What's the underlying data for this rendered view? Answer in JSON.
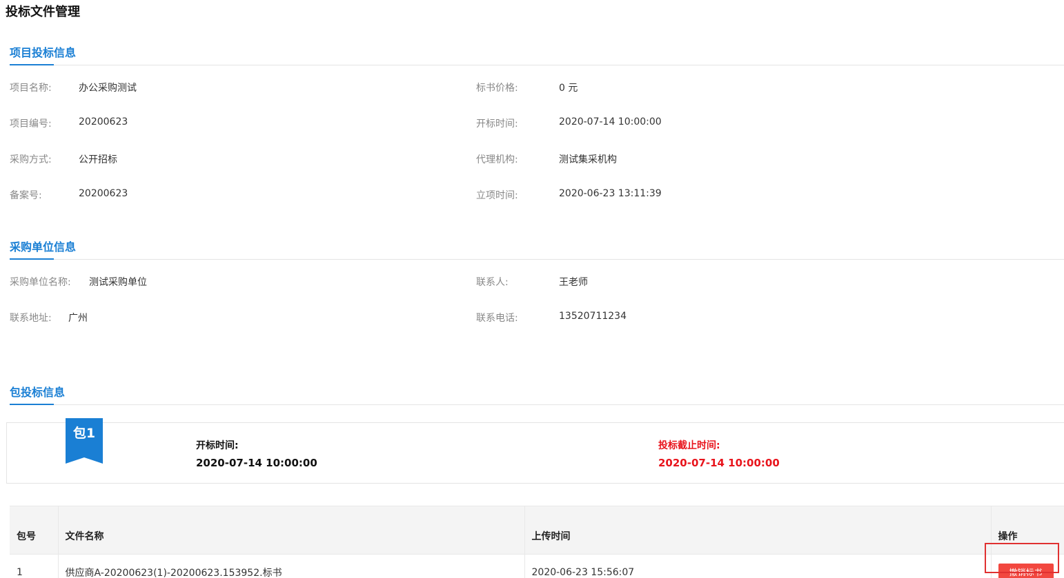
{
  "page": {
    "title": "投标文件管理"
  },
  "sections": {
    "project": "项目投标信息",
    "purchaser": "采购单位信息",
    "package": "包投标信息"
  },
  "project_info": {
    "name_label": "项目名称:",
    "name": "办公采购测试",
    "number_label": "项目编号:",
    "number": "20200623",
    "method_label": "采购方式:",
    "method": "公开招标",
    "record_label": "备案号:",
    "record": "20200623",
    "price_label": "标书价格:",
    "price": "0 元",
    "open_time_label": "开标时间:",
    "open_time": "2020-07-14 10:00:00",
    "agency_label": "代理机构:",
    "agency": "测试集采机构",
    "setup_time_label": "立项时间:",
    "setup_time": "2020-06-23 13:11:39"
  },
  "purchaser_info": {
    "unit_label": "采购单位名称:",
    "unit": "测试采购单位",
    "address_label": "联系地址:",
    "address": "广州",
    "contact_label": "联系人:",
    "contact": "王老师",
    "phone_label": "联系电话:",
    "phone": "13520711234"
  },
  "package": {
    "badge": "包1",
    "open_label": "开标时间:",
    "open_time": "2020-07-14 10:00:00",
    "deadline_label": "投标截止时间:",
    "deadline": "2020-07-14 10:00:00"
  },
  "files_table": {
    "headers": [
      "包号",
      "文件名称",
      "上传时间",
      "操作"
    ],
    "rows": [
      {
        "pkg": "1",
        "file": "供应商A-20200623(1)-20200623.153952.标书",
        "uploaded": "2020-06-23 15:56:07",
        "action": "撤销标书"
      }
    ]
  },
  "colors": {
    "accent": "#1a7fd4",
    "danger": "#e8141c",
    "button": "#f2473f"
  }
}
